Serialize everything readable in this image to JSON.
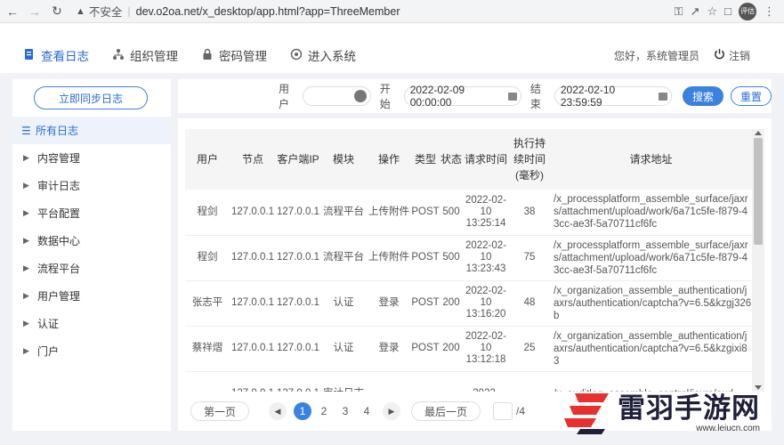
{
  "browser": {
    "security_label": "不安全",
    "url": "dev.o2oa.net/x_desktop/app.html?app=ThreeMember",
    "profile_label": "评估"
  },
  "header": {
    "nav": [
      {
        "label": "查看日志",
        "icon": "document-icon",
        "active": true
      },
      {
        "label": "组织管理",
        "icon": "org-icon",
        "active": false
      },
      {
        "label": "密码管理",
        "icon": "lock-icon",
        "active": false
      },
      {
        "label": "进入系统",
        "icon": "system-icon",
        "active": false
      }
    ],
    "greeting": "您好，系统管理员",
    "logout_label": "注销"
  },
  "sidebar": {
    "sync_button": "立即同步日志",
    "items": [
      {
        "label": "所有日志",
        "active": true
      },
      {
        "label": "内容管理",
        "active": false
      },
      {
        "label": "审计日志",
        "active": false
      },
      {
        "label": "平台配置",
        "active": false
      },
      {
        "label": "数据中心",
        "active": false
      },
      {
        "label": "流程平台",
        "active": false
      },
      {
        "label": "用户管理",
        "active": false
      },
      {
        "label": "认证",
        "active": false
      },
      {
        "label": "门户",
        "active": false
      }
    ]
  },
  "search": {
    "user_label": "用户",
    "start_label": "开始",
    "start_value": "2022-02-09 00:00:00",
    "end_label": "结束",
    "end_value": "2022-02-10 23:59:59",
    "search_button": "搜索",
    "reset_button": "重置"
  },
  "table": {
    "headers": [
      "用户",
      "节点",
      "客户端IP",
      "模块",
      "操作",
      "类型",
      "状态",
      "请求时间",
      "执行持续时间(毫秒)",
      "请求地址"
    ],
    "rows": [
      [
        "程剑",
        "127.0.0.1",
        "127.0.0.1",
        "流程平台",
        "上传附件",
        "POST",
        "500",
        "2022-02-10 13:25:14",
        "38",
        "/x_processplatform_assemble_surface/jaxrs/attachment/upload/work/6a71c5fe-f879-43cc-ae3f-5a70711cf6fc"
      ],
      [
        "程剑",
        "127.0.0.1",
        "127.0.0.1",
        "流程平台",
        "上传附件",
        "POST",
        "500",
        "2022-02-10 13:23:43",
        "75",
        "/x_processplatform_assemble_surface/jaxrs/attachment/upload/work/6a71c5fe-f879-43cc-ae3f-5a70711cf6fc"
      ],
      [
        "张志平",
        "127.0.0.1",
        "127.0.0.1",
        "认证",
        "登录",
        "POST",
        "200",
        "2022-02-10 13:16:20",
        "48",
        "/x_organization_assemble_authentication/jaxrs/authentication/captcha?v=6.5&kzgj326b"
      ],
      [
        "蔡祥熠",
        "127.0.0.1",
        "127.0.0.1",
        "认证",
        "登录",
        "POST",
        "200",
        "2022-02-10 13:12:18",
        "25",
        "/x_organization_assemble_authentication/jaxrs/authentication/captcha?v=6.5&kzgixi83"
      ],
      [
        "",
        "127.0.0.1",
        "127.0.0.1",
        "审计日志",
        "",
        "",
        "",
        "2022-",
        "",
        "/x_auditlog_assemble_control/jaxrs/aud"
      ]
    ]
  },
  "pager": {
    "first": "第一页",
    "pages": [
      "1",
      "2",
      "3",
      "4"
    ],
    "current": "1",
    "last": "最后一页",
    "total": "/4"
  },
  "watermark": {
    "title": "雷羽手游网",
    "url": "www.leiucn.com"
  }
}
